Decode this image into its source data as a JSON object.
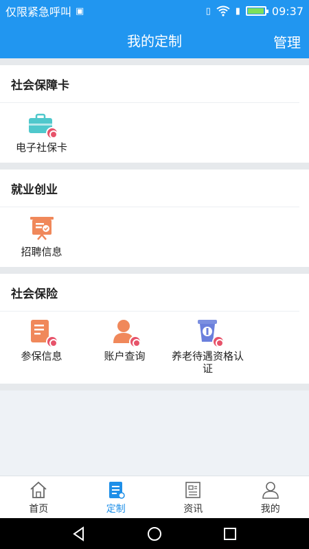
{
  "status_bar": {
    "carrier": "仅限紧急呼叫",
    "time": "09:37",
    "battery_level": 0.88
  },
  "header": {
    "title": "我的定制",
    "manage_label": "管理"
  },
  "sections": [
    {
      "title": "社会保障卡",
      "items": [
        {
          "label": "电子社保卡",
          "icon": "social-security-card-icon"
        }
      ]
    },
    {
      "title": "就业创业",
      "items": [
        {
          "label": "招聘信息",
          "icon": "recruitment-info-icon"
        }
      ]
    },
    {
      "title": "社会保险",
      "items": [
        {
          "label": "参保信息",
          "icon": "insurance-info-icon"
        },
        {
          "label": "账户查询",
          "icon": "account-query-icon"
        },
        {
          "label": "养老待遇资格认证",
          "icon": "pension-qualification-icon"
        }
      ]
    }
  ],
  "tabbar": {
    "items": [
      {
        "label": "首页",
        "icon": "home-icon"
      },
      {
        "label": "定制",
        "icon": "customize-icon",
        "active": true
      },
      {
        "label": "资讯",
        "icon": "news-icon"
      },
      {
        "label": "我的",
        "icon": "user-icon"
      }
    ]
  },
  "colors": {
    "brand": "#2196f0",
    "active_tab": "#1e8fe8",
    "badge": "#e7536a",
    "teal": "#4fc8cc",
    "orange": "#f0885a"
  }
}
